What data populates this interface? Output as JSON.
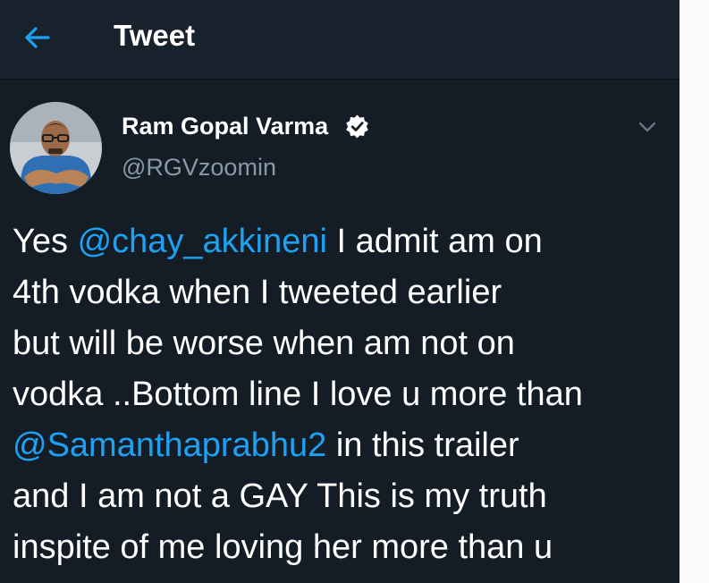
{
  "header": {
    "title": "Tweet",
    "back_icon": "arrow-left-icon",
    "accent": "#1da1f2",
    "background": "#18222d"
  },
  "author": {
    "name": "Ram Gopal Varma",
    "handle": "@RGVzoomin",
    "verified_icon": "verified-badge-icon",
    "menu_icon": "chevron-down-icon"
  },
  "tweet": {
    "lines": [
      {
        "segments": [
          {
            "text": "Yes "
          },
          {
            "text": "@chay_akkineni",
            "mention": true
          },
          {
            "text": " I admit am on"
          }
        ]
      },
      {
        "segments": [
          {
            "text": "4th vodka when I tweeted earlier"
          }
        ]
      },
      {
        "segments": [
          {
            "text": "but will be worse when am not on"
          }
        ]
      },
      {
        "segments": [
          {
            "text": "vodka ..Bottom line I love u more than"
          }
        ]
      },
      {
        "segments": [
          {
            "text": "@Samanthaprabhu2",
            "mention": true
          },
          {
            "text": " in this trailer"
          }
        ]
      },
      {
        "segments": [
          {
            "text": "and I am not a GAY This is my truth"
          }
        ]
      },
      {
        "segments": [
          {
            "text": "inspite of me loving her more than u"
          }
        ]
      }
    ]
  },
  "colors": {
    "background": "#141d26",
    "text": "#ffffff",
    "secondary_text": "#8899a6",
    "mention": "#1da1f2"
  }
}
